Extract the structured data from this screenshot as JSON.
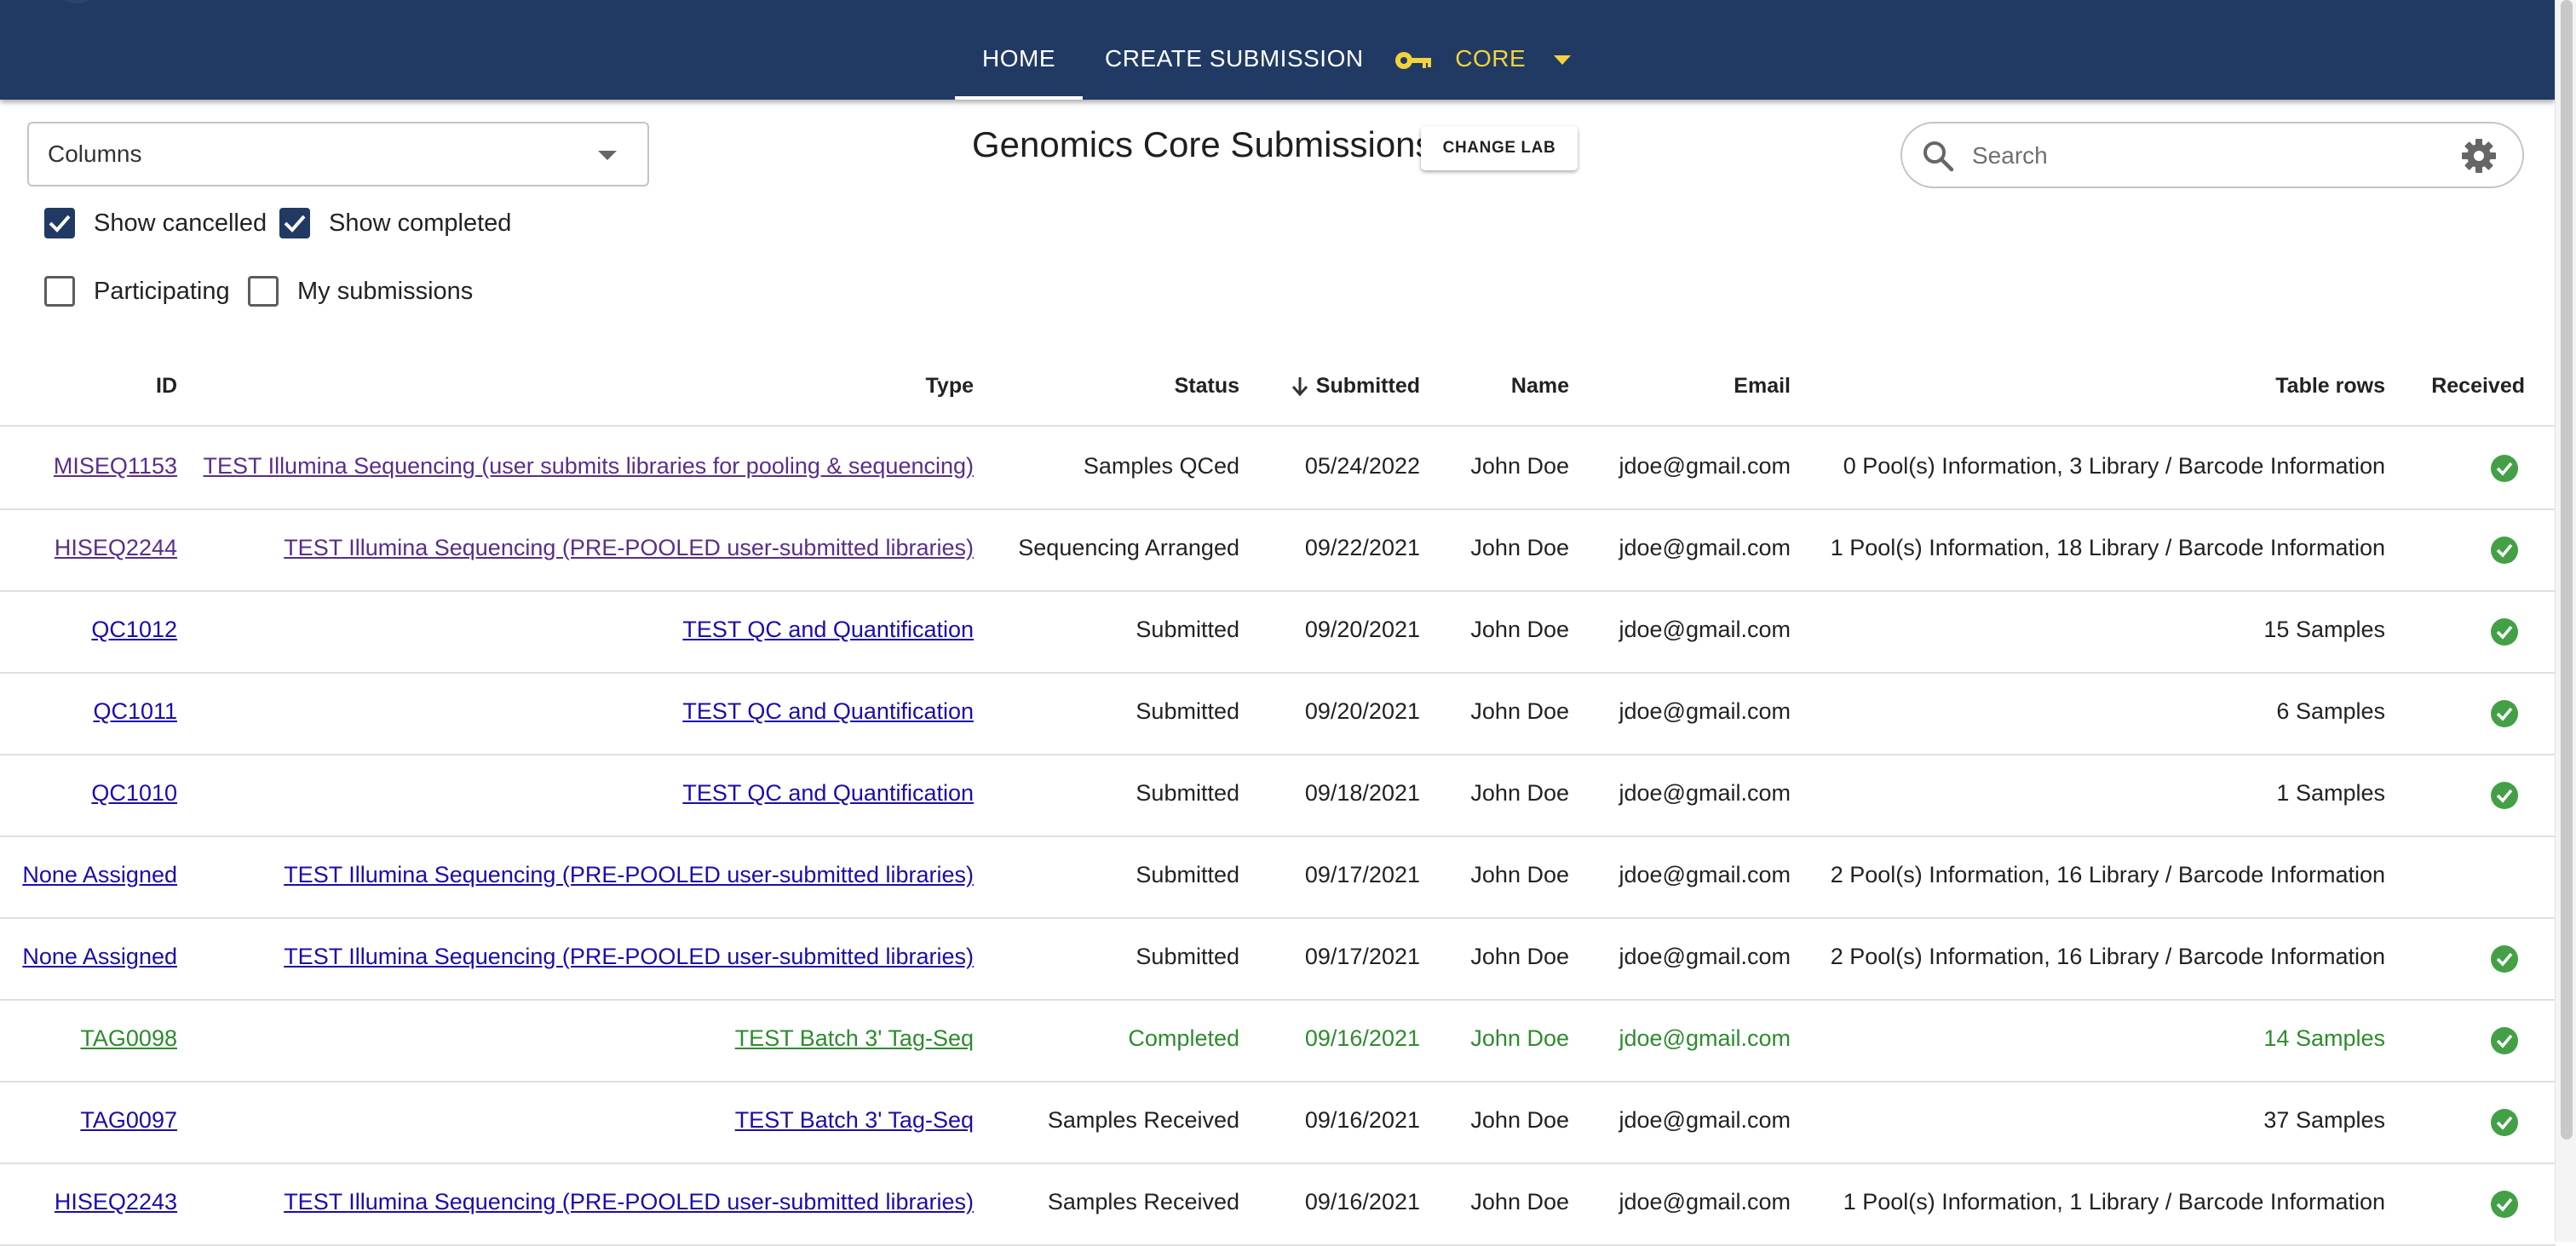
{
  "nav": {
    "tabs": [
      {
        "label": "HOME"
      },
      {
        "label": "CREATE SUBMISSION"
      },
      {
        "label": "CORE"
      }
    ]
  },
  "toolbar": {
    "columns_label": "Columns",
    "title": "Genomics Core Submissions",
    "change_lab_label": "CHANGE LAB",
    "search_placeholder": "Search"
  },
  "filters": [
    {
      "label": "Show cancelled",
      "checked": true
    },
    {
      "label": "Show completed",
      "checked": true
    },
    {
      "label": "Participating",
      "checked": false
    },
    {
      "label": "My submissions",
      "checked": false
    }
  ],
  "table": {
    "headers": {
      "id": "ID",
      "type": "Type",
      "status": "Status",
      "submitted": "Submitted",
      "name": "Name",
      "email": "Email",
      "table_rows": "Table rows",
      "received": "Received"
    },
    "rows": [
      {
        "id": "MISEQ1153",
        "type": "TEST Illumina Sequencing (user submits libraries for pooling & sequencing)",
        "status": "Samples QCed",
        "submitted": "05/24/2022",
        "name": "John Doe",
        "email": "jdoe@gmail.com",
        "table_rows": "0 Pool(s) Information, 3 Library / Barcode Information",
        "received": true
      },
      {
        "id": "HISEQ2244",
        "type": "TEST Illumina Sequencing (PRE-POOLED user-submitted libraries)",
        "status": "Sequencing Arranged",
        "submitted": "09/22/2021",
        "name": "John Doe",
        "email": "jdoe@gmail.com",
        "table_rows": "1 Pool(s) Information, 18 Library / Barcode Information",
        "received": true
      },
      {
        "id": "QC1012",
        "type": "TEST QC and Quantification",
        "status": "Submitted",
        "submitted": "09/20/2021",
        "name": "John Doe",
        "email": "jdoe@gmail.com",
        "table_rows": "15 Samples",
        "received": true
      },
      {
        "id": "QC1011",
        "type": "TEST QC and Quantification",
        "status": "Submitted",
        "submitted": "09/20/2021",
        "name": "John Doe",
        "email": "jdoe@gmail.com",
        "table_rows": "6 Samples",
        "received": true
      },
      {
        "id": "QC1010",
        "type": "TEST QC and Quantification",
        "status": "Submitted",
        "submitted": "09/18/2021",
        "name": "John Doe",
        "email": "jdoe@gmail.com",
        "table_rows": "1 Samples",
        "received": true
      },
      {
        "id": "None Assigned",
        "type": "TEST Illumina Sequencing (PRE-POOLED user-submitted libraries)",
        "status": "Submitted",
        "submitted": "09/17/2021",
        "name": "John Doe",
        "email": "jdoe@gmail.com",
        "table_rows": "2 Pool(s) Information, 16 Library / Barcode Information",
        "received": false
      },
      {
        "id": "None Assigned",
        "type": "TEST Illumina Sequencing (PRE-POOLED user-submitted libraries)",
        "status": "Submitted",
        "submitted": "09/17/2021",
        "name": "John Doe",
        "email": "jdoe@gmail.com",
        "table_rows": "2 Pool(s) Information, 16 Library / Barcode Information",
        "received": true
      },
      {
        "id": "TAG0098",
        "type": "TEST Batch 3' Tag-Seq",
        "status": "Completed",
        "submitted": "09/16/2021",
        "name": "John Doe",
        "email": "jdoe@gmail.com",
        "table_rows": "14 Samples",
        "received": true
      },
      {
        "id": "TAG0097",
        "type": "TEST Batch 3' Tag-Seq",
        "status": "Samples Received",
        "submitted": "09/16/2021",
        "name": "John Doe",
        "email": "jdoe@gmail.com",
        "table_rows": "37 Samples",
        "received": true
      },
      {
        "id": "HISEQ2243",
        "type": "TEST Illumina Sequencing (PRE-POOLED user-submitted libraries)",
        "status": "Samples Received",
        "submitted": "09/16/2021",
        "name": "John Doe",
        "email": "jdoe@gmail.com",
        "table_rows": "1 Pool(s) Information, 1 Library / Barcode Information",
        "received": true
      }
    ]
  }
}
